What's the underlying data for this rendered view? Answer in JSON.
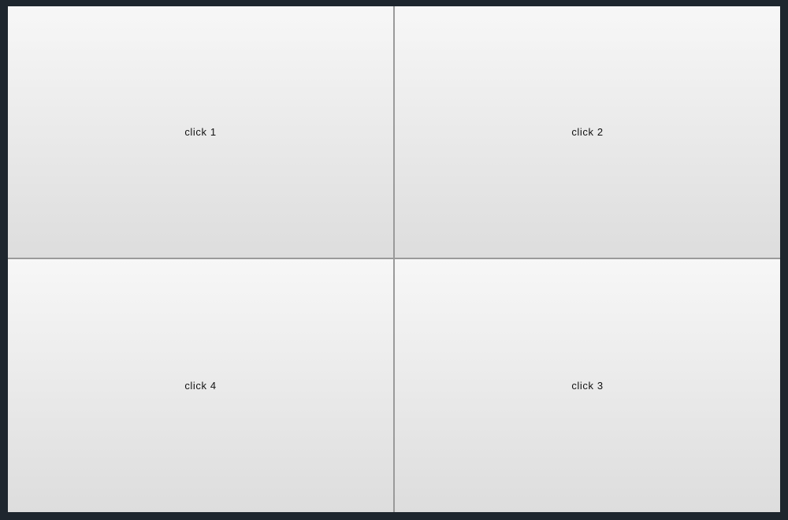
{
  "buttons": {
    "top_left": "click 1",
    "top_right": "click 2",
    "bottom_left": "click 4",
    "bottom_right": "click 3"
  }
}
